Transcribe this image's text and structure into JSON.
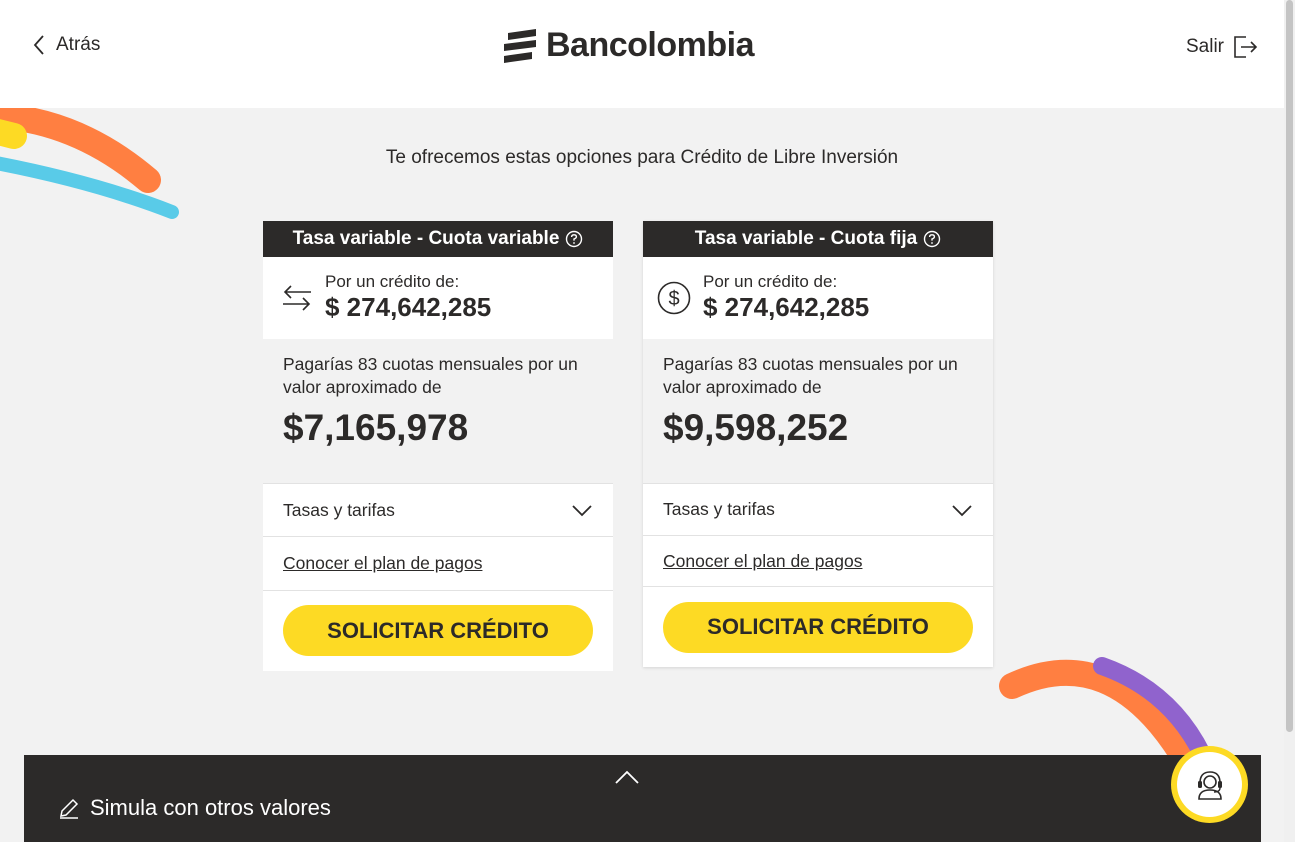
{
  "header": {
    "back_label": "Atrás",
    "brand": "Bancolombia",
    "exit_label": "Salir"
  },
  "subtitle": "Te ofrecemos estas opciones para Crédito de Libre Inversión",
  "cards": [
    {
      "title": "Tasa variable - Cuota variable",
      "amount_label": "Por un crédito de:",
      "amount": "$ 274,642,285",
      "icon": "arrows-exchange-icon",
      "quota_text": "Pagarías 83 cuotas mensuales por un valor aproximado de",
      "quota_value": "$7,165,978",
      "rates_label": "Tasas y tarifas",
      "plan_link": "Conocer el plan de pagos",
      "button": "SOLICITAR CRÉDITO"
    },
    {
      "title": "Tasa variable - Cuota fija",
      "amount_label": "Por un crédito de:",
      "amount": "$ 274,642,285",
      "icon": "dollar-circle-icon",
      "quota_text": "Pagarías 83 cuotas mensuales por un valor aproximado de",
      "quota_value": "$9,598,252",
      "rates_label": "Tasas y tarifas",
      "plan_link": "Conocer el plan de pagos",
      "button": "SOLICITAR CRÉDITO"
    }
  ],
  "footer": {
    "simulate_label": "Simula con otros valores"
  },
  "colors": {
    "brand_yellow": "#fdda24",
    "dark": "#2c2a29",
    "orange": "#ff7f41",
    "cyan": "#59cbe8",
    "purple": "#9063cd"
  }
}
